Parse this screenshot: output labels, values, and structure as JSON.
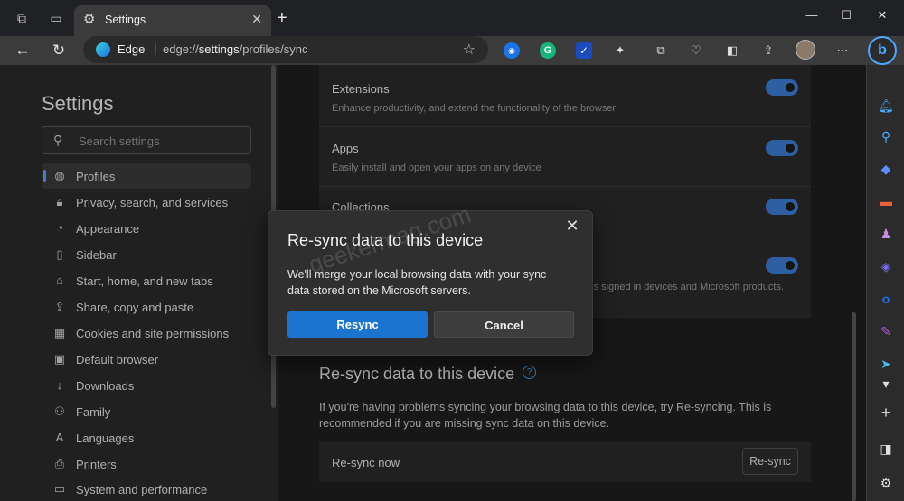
{
  "browser": {
    "tab_title": "Settings",
    "address_brand": "Edge",
    "url_scheme": "edge://",
    "url_host": "settings",
    "url_path": "/profiles/sync"
  },
  "sidebar": {
    "title": "Settings",
    "search_placeholder": "Search settings",
    "items": [
      {
        "label": "Profiles",
        "icon": "profile-icon",
        "active": true
      },
      {
        "label": "Privacy, search, and services",
        "icon": "lock-icon"
      },
      {
        "label": "Appearance",
        "icon": "palette-icon"
      },
      {
        "label": "Sidebar",
        "icon": "sidebar-icon"
      },
      {
        "label": "Start, home, and new tabs",
        "icon": "home-icon"
      },
      {
        "label": "Share, copy and paste",
        "icon": "share-icon"
      },
      {
        "label": "Cookies and site permissions",
        "icon": "cookie-icon"
      },
      {
        "label": "Default browser",
        "icon": "browser-icon"
      },
      {
        "label": "Downloads",
        "icon": "download-icon"
      },
      {
        "label": "Family",
        "icon": "family-icon"
      },
      {
        "label": "Languages",
        "icon": "language-icon"
      },
      {
        "label": "Printers",
        "icon": "printer-icon"
      },
      {
        "label": "System and performance",
        "icon": "laptop-icon"
      }
    ]
  },
  "sync_items": [
    {
      "title": "Extensions",
      "desc": "Enhance productivity, and extend the functionality of the browser",
      "enabled": true
    },
    {
      "title": "Apps",
      "desc": "Easily install and open your apps on any device",
      "enabled": true
    },
    {
      "title": "Collections",
      "desc": "",
      "enabled": true
    },
    {
      "title": "",
      "desc": "oss signed in devices and Microsoft products.",
      "enabled": true
    }
  ],
  "resync_section": {
    "heading": "Re-sync data to this device",
    "help_icon": "?",
    "description": "If you're having problems syncing your browsing data to this device, try Re-syncing. This is recommended if you are missing sync data on this device.",
    "row_label": "Re-sync now",
    "row_button": "Re-sync"
  },
  "dialog": {
    "title": "Re-sync data to this device",
    "close": "✕",
    "body": "We'll merge your local browsing data with your sync data stored on the Microsoft servers.",
    "primary": "Resync",
    "secondary": "Cancel"
  },
  "watermark": "geekermag.com",
  "colors": {
    "accent": "#1b75d0",
    "toggle_on": "#3d7fd8"
  }
}
